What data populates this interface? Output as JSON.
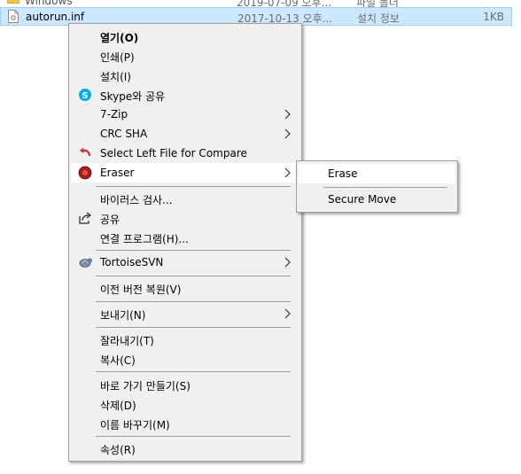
{
  "file_list": {
    "prev_row": {
      "name": "Windows",
      "date": "2019-07-09 오후...",
      "type": "파일 폴더"
    },
    "selected_row": {
      "name": "autorun.inf",
      "date": "2017-10-13 오후...",
      "type": "설치 정보",
      "size": "1KB"
    }
  },
  "context_menu": {
    "open": "열기(O)",
    "print": "인쇄(P)",
    "install": "설치(I)",
    "skype_share": "Skype와 공유",
    "sevenzip": "7-Zip",
    "crc_sha": "CRC SHA",
    "select_left": "Select Left File for Compare",
    "eraser": "Eraser",
    "virus_scan": "바이러스 검사...",
    "share": "공유",
    "open_with": "연결 프로그램(H)...",
    "tortoisesvn": "TortoiseSVN",
    "restore_prev": "이전 버전 복원(V)",
    "send_to": "보내기(N)",
    "cut": "잘라내기(T)",
    "copy": "복사(C)",
    "create_shortcut": "바로 가기 만들기(S)",
    "delete": "삭제(D)",
    "rename": "이름 바꾸기(M)",
    "properties": "속성(R)"
  },
  "eraser_submenu": {
    "erase": "Erase",
    "secure_move": "Secure Move"
  },
  "colors": {
    "menu_bg": "#f0f0f0",
    "selection_bg": "#cce8ff",
    "separator": "#a0a0a0"
  }
}
